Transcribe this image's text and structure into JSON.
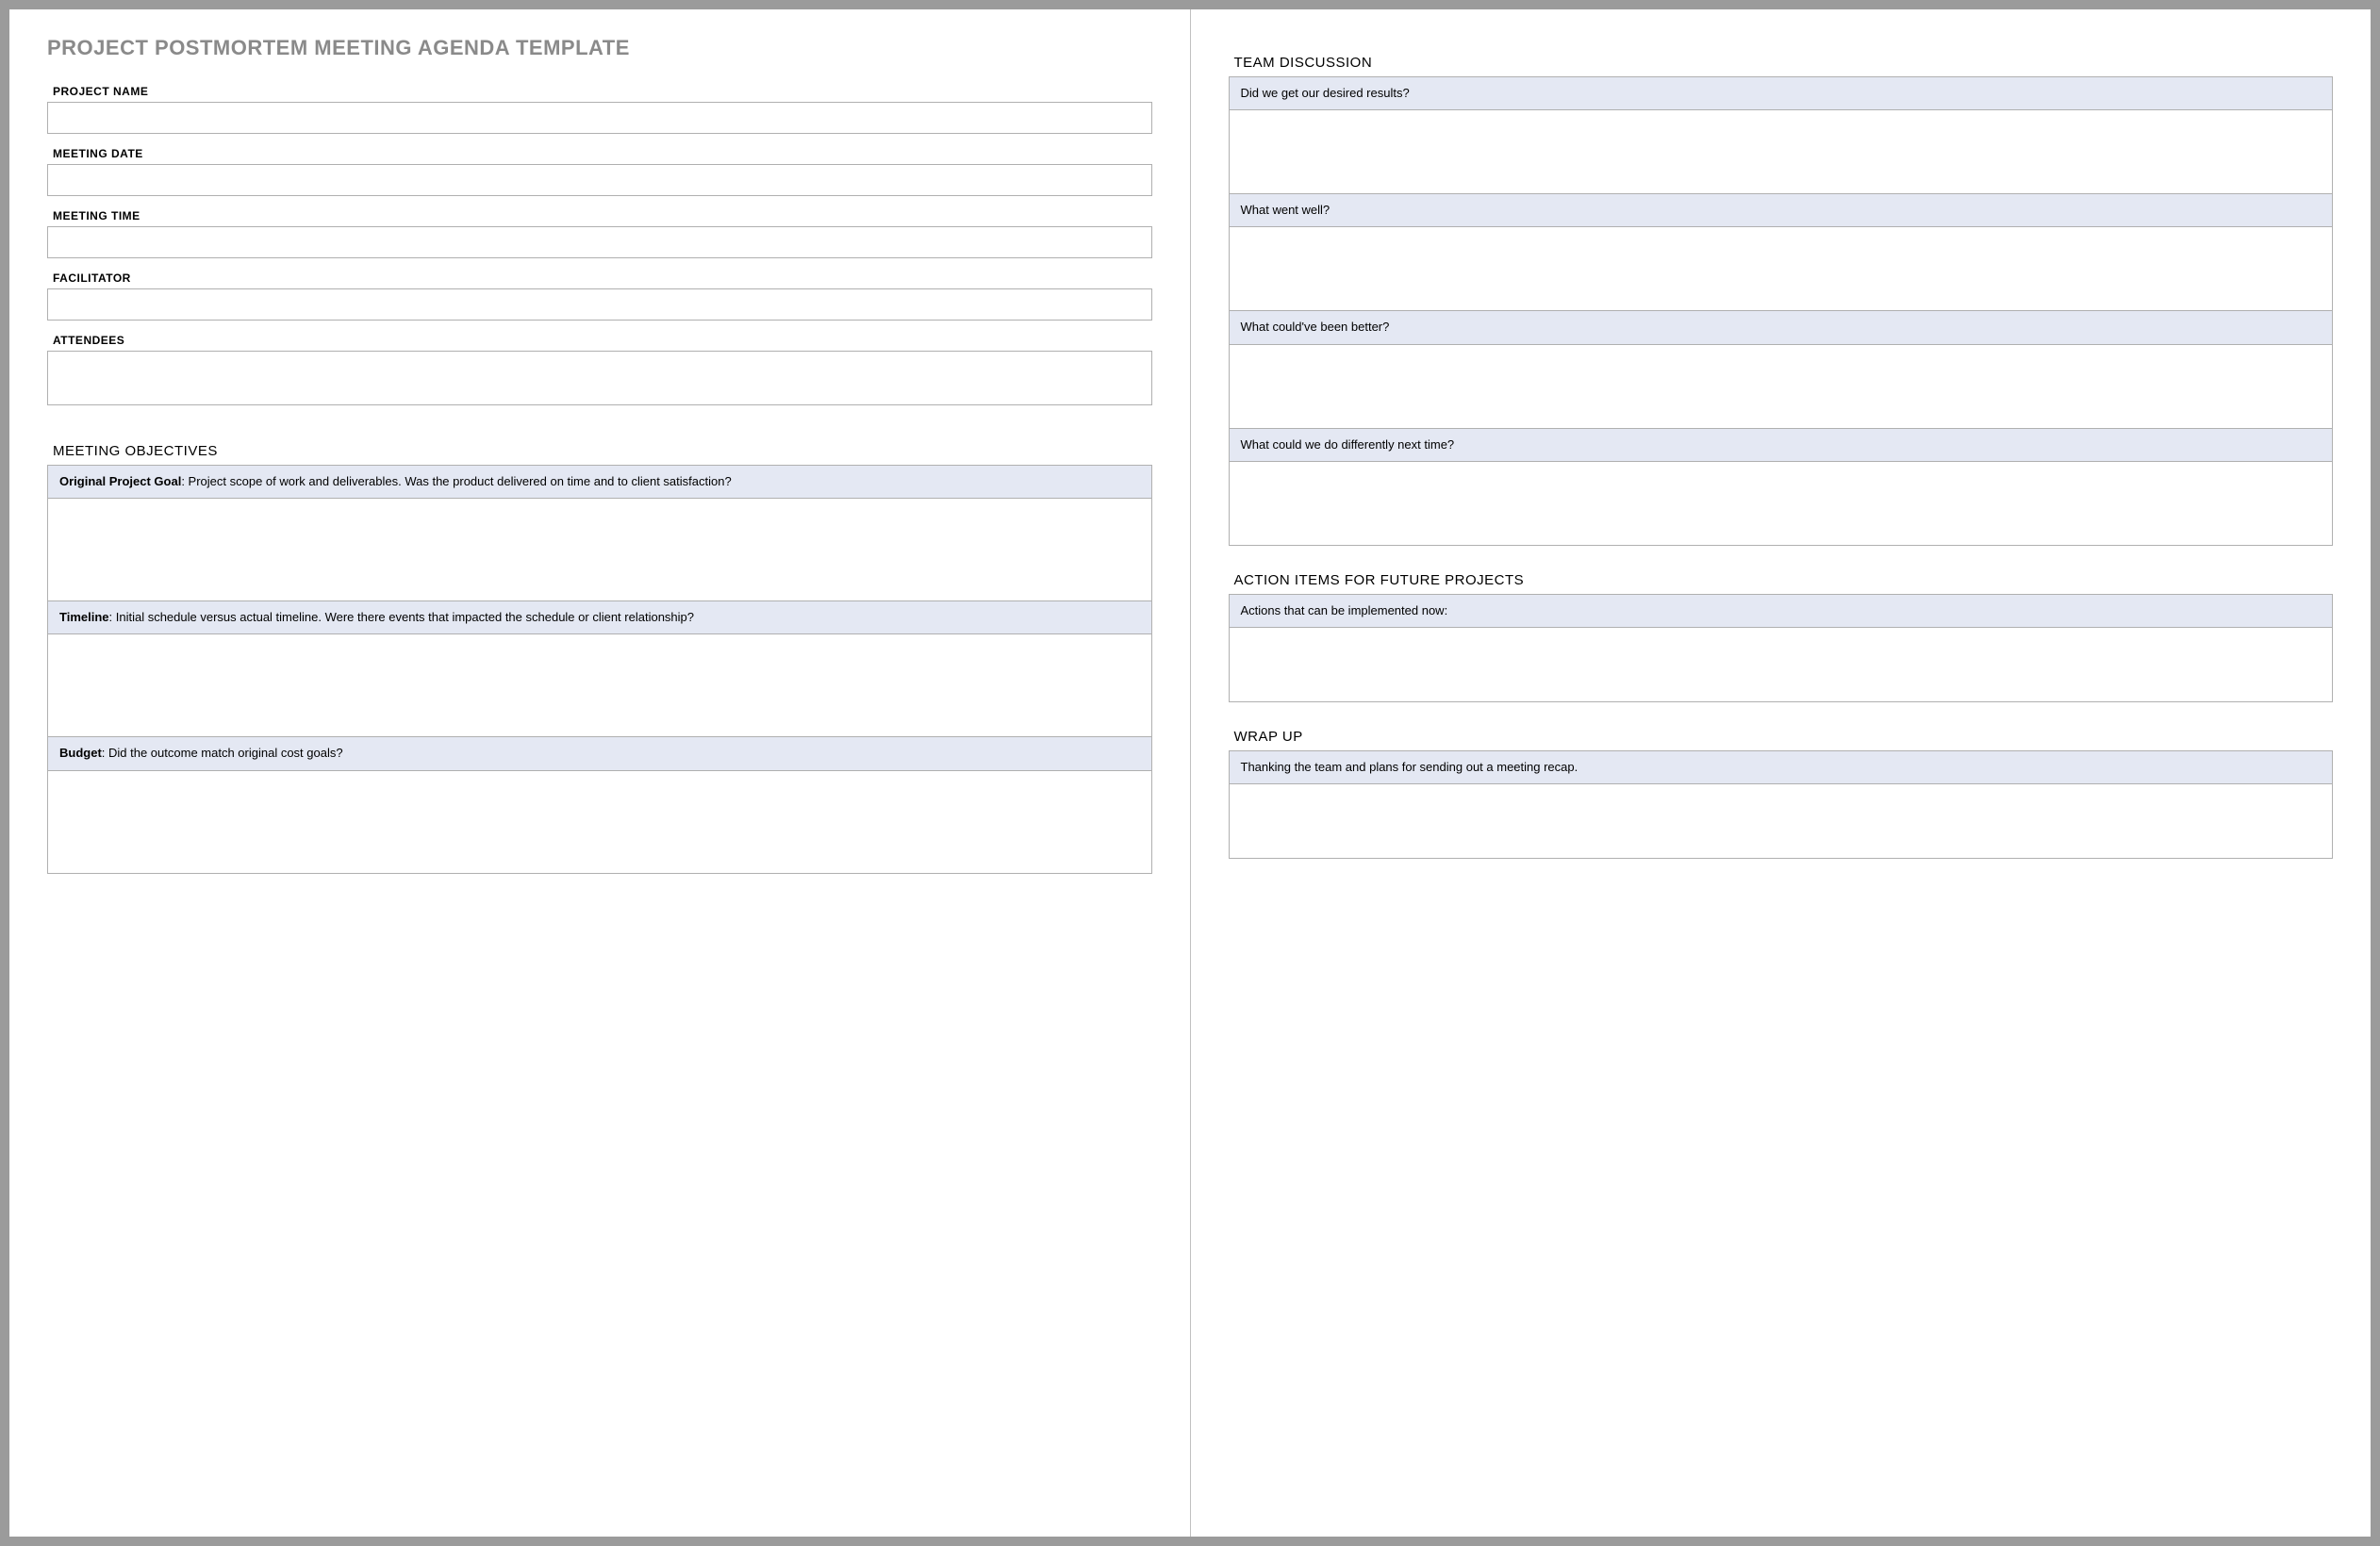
{
  "title": "PROJECT POSTMORTEM MEETING AGENDA TEMPLATE",
  "fields": {
    "project_name": {
      "label": "PROJECT NAME"
    },
    "meeting_date": {
      "label": "MEETING DATE"
    },
    "meeting_time": {
      "label": "MEETING TIME"
    },
    "facilitator": {
      "label": "FACILITATOR"
    },
    "attendees": {
      "label": "ATTENDEES"
    }
  },
  "meeting_objectives": {
    "title": "MEETING OBJECTIVES",
    "items": [
      {
        "bold": "Original Project Goal",
        "text": ": Project scope of work and deliverables. Was the product delivered on time and to client satisfaction?"
      },
      {
        "bold": "Timeline",
        "text": ": Initial schedule versus actual timeline. Were there events that impacted the schedule or client relationship?"
      },
      {
        "bold": "Budget",
        "text": ": Did the outcome match original cost goals?"
      }
    ]
  },
  "team_discussion": {
    "title": "TEAM DISCUSSION",
    "items": [
      {
        "text": "Did we get our desired results?"
      },
      {
        "text": "What went well?"
      },
      {
        "text": "What could've been better?"
      },
      {
        "text": "What could we do differently next time?"
      }
    ]
  },
  "action_items": {
    "title": "ACTION ITEMS FOR FUTURE PROJECTS",
    "items": [
      {
        "text": "Actions that can be implemented now:"
      }
    ]
  },
  "wrap_up": {
    "title": "WRAP UP",
    "items": [
      {
        "text": "Thanking the team and plans for sending out a meeting recap."
      }
    ]
  }
}
